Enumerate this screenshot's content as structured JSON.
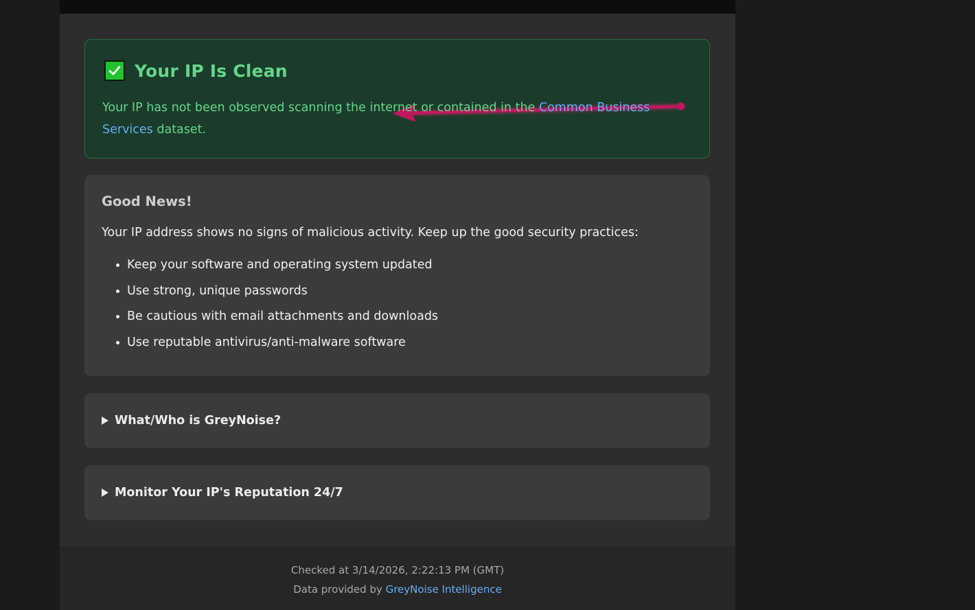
{
  "status": {
    "title": "Your IP Is Clean",
    "description_before": "Your IP has not been observed scanning the internet or contained in the ",
    "link_text": "Common Business Services",
    "description_after": " dataset.",
    "check_icon": "check-box-icon",
    "annotation": "arrow-annotation"
  },
  "good_news": {
    "title": "Good News!",
    "intro": "Your IP address shows no signs of malicious activity. Keep up the good security practices:",
    "tips": [
      "Keep your software and operating system updated",
      "Use strong, unique passwords",
      "Be cautious with email attachments and downloads",
      "Use reputable antivirus/anti-malware software"
    ]
  },
  "faq": [
    {
      "label": "What/Who is GreyNoise?"
    },
    {
      "label": "Monitor Your IP's Reputation 24/7"
    }
  ],
  "footer": {
    "checked": "Checked at 3/14/2026, 2:22:13 PM (GMT)",
    "provider_prefix": "Data provided by ",
    "provider_link": "GreyNoise Intelligence"
  },
  "colors": {
    "status_bg": "#1b3c2a",
    "status_text": "#67d58d",
    "link": "#66aef7",
    "arrow": "#c0185e"
  }
}
